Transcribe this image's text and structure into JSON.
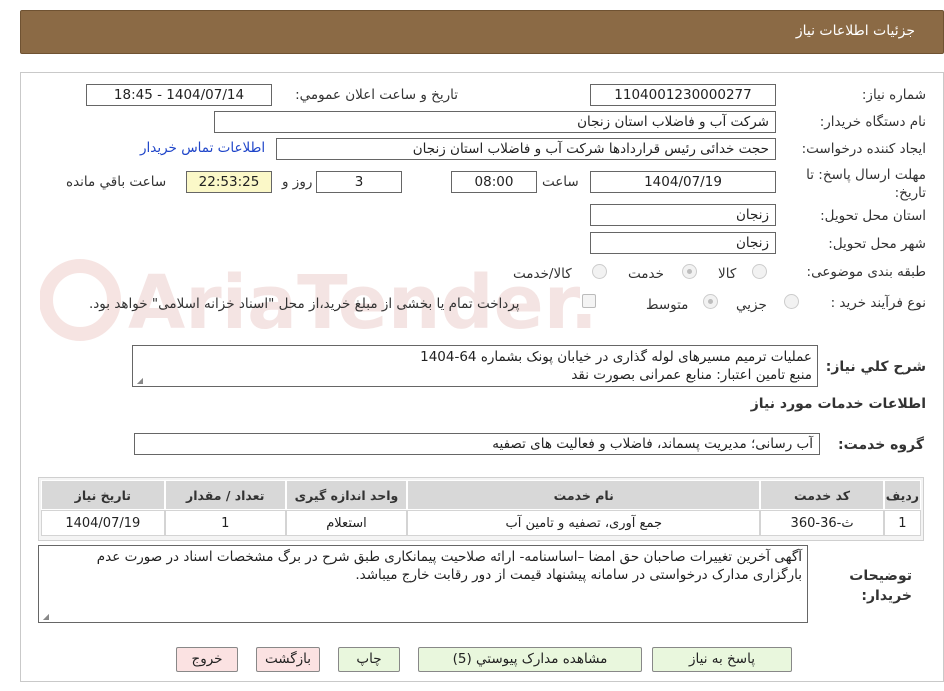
{
  "header": {
    "title": "جزئیات اطلاعات نیاز"
  },
  "fields": {
    "need_number_label": "شماره نیاز:",
    "need_number": "1104001230000277",
    "announce_label": "تاریخ و ساعت اعلان عمومي:",
    "announce_value": "1404/07/14 - 18:45",
    "buyer_org_label": "نام دستگاه خریدار:",
    "buyer_org": "شرکت آب و فاضلاب استان زنجان",
    "requester_label": "ایجاد کننده درخواست:",
    "requester": "حجت  خدائی رئیس قراردادها شرکت آب و فاضلاب استان زنجان",
    "contact_link": "اطلاعات تماس خریدار",
    "deadline_label": "مهلت ارسال پاسخ: تا تاریخ:",
    "deadline_date": "1404/07/19",
    "time_label": "ساعت",
    "deadline_time": "08:00",
    "days_value": "3",
    "days_label": "روز و",
    "remaining_time": "22:53:25",
    "remaining_label": "ساعت باقي مانده",
    "province_label": "استان محل تحویل:",
    "province": "زنجان",
    "city_label": "شهر محل تحویل:",
    "city": "زنجان",
    "category_label": "طبقه بندی موضوعی:",
    "category_options": [
      "کالا",
      "خدمت",
      "کالا/خدمت"
    ],
    "purchase_type_label": "نوع فرآیند خرید :",
    "purchase_type_options": [
      "جزيي",
      "متوسط"
    ],
    "payment_note": "پرداخت تمام یا بخشی از مبلغ خرید،از محل \"اسناد خزانه اسلامی\" خواهد بود.",
    "general_desc_label": "شرح کلي نیاز:",
    "general_desc_line1": "عملیات ترمیم مسیرهای لوله گذاری در خیابان پونک بشماره 64-1404",
    "general_desc_line2": "منبع تامین اعتبار: منابع عمرانی بصورت نقد",
    "services_section_title": "اطلاعات خدمات مورد نیاز",
    "service_group_label": "گروه خدمت:",
    "service_group": "آب رسانی؛ مدیریت پسماند، فاضلاب و فعالیت های تصفیه",
    "buyer_notes_label": "توضیحات خریدار:",
    "buyer_notes": "آگهی آخرین تغییرات صاحبان حق امضا –اساسنامه- ارائه صلاحیت پیمانکاری طبق شرح در برگ مشخصات اسناد در صورت عدم بارگزاری مدارک درخواستی در سامانه پیشنهاد قیمت از دور رقابت خارج میباشد."
  },
  "table": {
    "headers": [
      "ردیف",
      "کد خدمت",
      "نام خدمت",
      "واحد اندازه گیری",
      "تعداد / مقدار",
      "تاریخ نیاز"
    ],
    "rows": [
      [
        "1",
        "ث-36-360",
        "جمع آوری، تصفیه و تامین آب",
        "استعلام",
        "1",
        "1404/07/19"
      ]
    ]
  },
  "buttons": {
    "reply": "پاسخ به نیاز",
    "attachments": "مشاهده مدارک پیوستي (5)",
    "print": "چاپ",
    "back": "بازگشت",
    "exit": "خروج"
  },
  "watermark_text": "AriaTender.neT",
  "colors": {
    "header_bg": "#8b6a45",
    "link": "#1f45c9",
    "green_button": "#e9f7dd",
    "pink_button": "#fbe2e2",
    "countdown_bg": "#fbf8c8"
  }
}
